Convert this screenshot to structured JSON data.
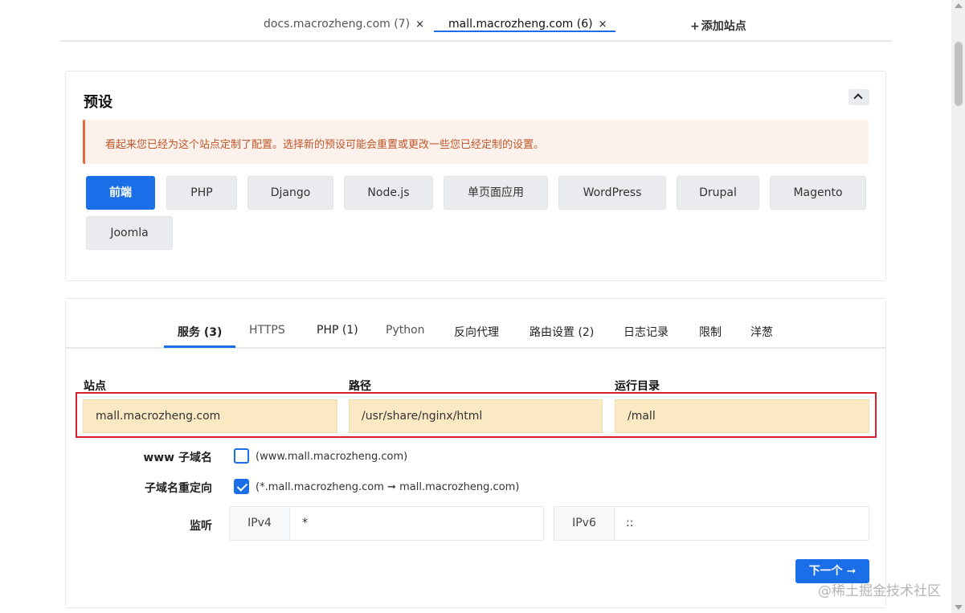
{
  "site_tabs": [
    {
      "label": "docs.macrozheng.com (7)",
      "close": "×"
    },
    {
      "label": "mall.macrozheng.com (6)",
      "close": "×"
    }
  ],
  "add_site": {
    "plus": "+",
    "label": "添加站点"
  },
  "preset": {
    "title": "预设",
    "warning": "看起来您已经为这个站点定制了配置。选择新的预设可能会重置或更改一些您已经定制的设置。",
    "buttons": [
      "前端",
      "PHP",
      "Django",
      "Node.js",
      "单页面应用",
      "WordPress",
      "Drupal",
      "Magento",
      "Joomla"
    ],
    "active": "前端"
  },
  "server": {
    "tabs": [
      "服务 (3)",
      "HTTPS",
      "PHP (1)",
      "Python",
      "反向代理",
      "路由设置 (2)",
      "日志记录",
      "限制",
      "洋葱"
    ],
    "active_tab": "服务 (3)",
    "fields": {
      "site_label": "站点",
      "site_value": "mall.macrozheng.com",
      "path_label": "路径",
      "path_value": "/usr/share/nginx/html",
      "root_label": "运行目录",
      "root_value": "/mall"
    },
    "www": {
      "label": "www 子域名",
      "checked": false,
      "hint": "(www.mall.macrozheng.com)"
    },
    "redirect": {
      "label": "子域名重定向",
      "checked": true,
      "hint": "(*.mall.macrozheng.com ➞ mall.macrozheng.com)"
    },
    "listen": {
      "label": "监听",
      "ipv4_label": "IPv4",
      "ipv4_value": "*",
      "ipv6_label": "IPv6",
      "ipv6_value": "::"
    },
    "next": {
      "label": "下一个",
      "arrow": "➞"
    }
  },
  "watermark": "@稀土掘金技术社区",
  "colors": {
    "accent": "#1a6ee8",
    "warning": "#c0562a",
    "highlight": "#d8202c",
    "field_bg": "#fbe9c4"
  }
}
